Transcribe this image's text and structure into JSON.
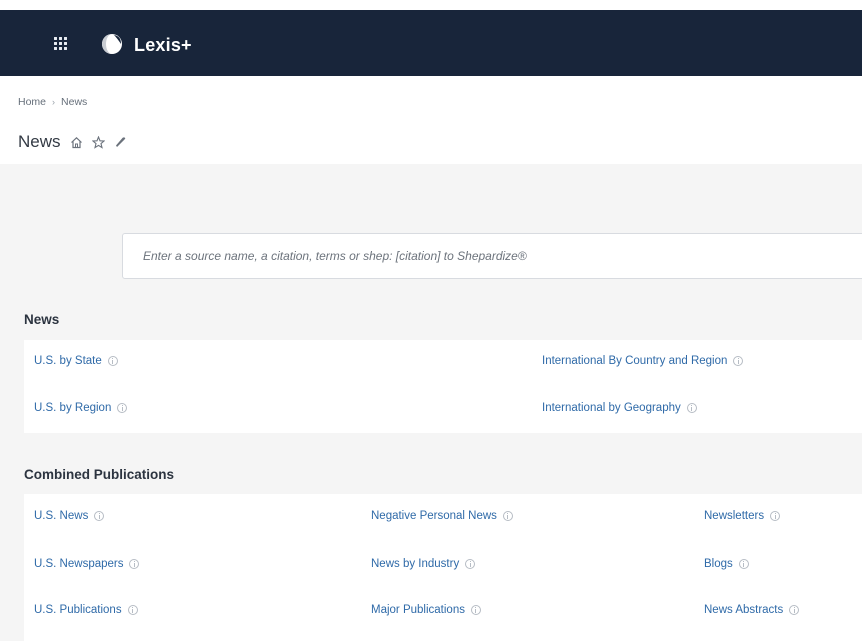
{
  "header": {
    "app_name": "Lexis+",
    "apps_icon": "apps-grid-icon",
    "logo_icon": "lexis-logo-icon",
    "background_color": "#18253a"
  },
  "breadcrumb": {
    "items": [
      "Home",
      "News"
    ]
  },
  "page": {
    "title": "News",
    "actions": [
      "home-icon",
      "star-icon",
      "pin-icon"
    ]
  },
  "search": {
    "placeholder": "Enter a source name, a citation, terms or shep: [citation] to Shepardize®",
    "value": ""
  },
  "news_section": {
    "heading": "News",
    "links": [
      "U.S. by State",
      "U.S. by Region",
      "International By Country and Region",
      "International by Geography"
    ]
  },
  "combined_section": {
    "heading": "Combined Publications",
    "links": [
      "U.S. News",
      "U.S. Newspapers",
      "U.S. Publications",
      "Negative Personal News",
      "News by Industry",
      "Major Publications",
      "Newsletters",
      "Blogs",
      "News Abstracts"
    ]
  },
  "colors": {
    "link": "#2f6aa8",
    "body_background": "#f5f5f5"
  }
}
